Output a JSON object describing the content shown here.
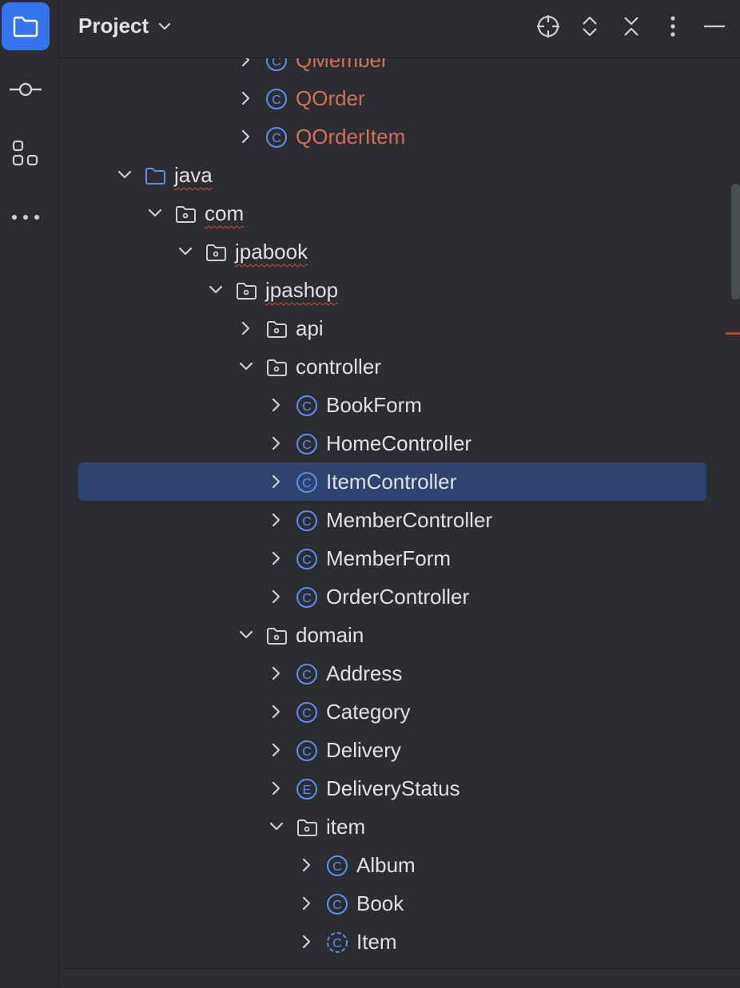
{
  "panel": {
    "title": "Project"
  },
  "header_icons": [
    "locate-icon",
    "expand-collapse-icon",
    "collapse-all-icon",
    "more-options-icon",
    "hide-panel-icon"
  ],
  "sidebar_icons": [
    "project-folder-icon",
    "commit-icon",
    "structure-icon",
    "more-tools-icon"
  ],
  "colors": {
    "accent": "#3574f0",
    "selection": "#2e436e",
    "generated_class_text": "#d46e5a",
    "class_icon": "#5b8ef0",
    "error_underline": "#d44d4d"
  },
  "tree": [
    {
      "label": "QMember",
      "depth": 5,
      "type": "class",
      "expanded": false,
      "generated": true
    },
    {
      "label": "QOrder",
      "depth": 5,
      "type": "class",
      "expanded": false,
      "generated": true
    },
    {
      "label": "QOrderItem",
      "depth": 5,
      "type": "class",
      "expanded": false,
      "generated": true
    },
    {
      "label": "java",
      "depth": 1,
      "type": "source-folder",
      "expanded": true,
      "error": true
    },
    {
      "label": "com",
      "depth": 2,
      "type": "package",
      "expanded": true,
      "error": true
    },
    {
      "label": "jpabook",
      "depth": 3,
      "type": "package",
      "expanded": true,
      "error": true
    },
    {
      "label": "jpashop",
      "depth": 4,
      "type": "package",
      "expanded": true,
      "error": true
    },
    {
      "label": "api",
      "depth": 5,
      "type": "package",
      "expanded": false
    },
    {
      "label": "controller",
      "depth": 5,
      "type": "package",
      "expanded": true
    },
    {
      "label": "BookForm",
      "depth": 6,
      "type": "class",
      "expanded": false
    },
    {
      "label": "HomeController",
      "depth": 6,
      "type": "class",
      "expanded": false
    },
    {
      "label": "ItemController",
      "depth": 6,
      "type": "class",
      "expanded": false,
      "selected": true
    },
    {
      "label": "MemberController",
      "depth": 6,
      "type": "class",
      "expanded": false
    },
    {
      "label": "MemberForm",
      "depth": 6,
      "type": "class",
      "expanded": false
    },
    {
      "label": "OrderController",
      "depth": 6,
      "type": "class",
      "expanded": false
    },
    {
      "label": "domain",
      "depth": 5,
      "type": "package",
      "expanded": true
    },
    {
      "label": "Address",
      "depth": 6,
      "type": "class",
      "expanded": false
    },
    {
      "label": "Category",
      "depth": 6,
      "type": "class",
      "expanded": false
    },
    {
      "label": "Delivery",
      "depth": 6,
      "type": "class",
      "expanded": false
    },
    {
      "label": "DeliveryStatus",
      "depth": 6,
      "type": "enum",
      "expanded": false
    },
    {
      "label": "item",
      "depth": 6,
      "type": "package",
      "expanded": true
    },
    {
      "label": "Album",
      "depth": 7,
      "type": "class",
      "expanded": false
    },
    {
      "label": "Book",
      "depth": 7,
      "type": "class",
      "expanded": false
    },
    {
      "label": "Item",
      "depth": 7,
      "type": "abstract-class",
      "expanded": false
    }
  ]
}
